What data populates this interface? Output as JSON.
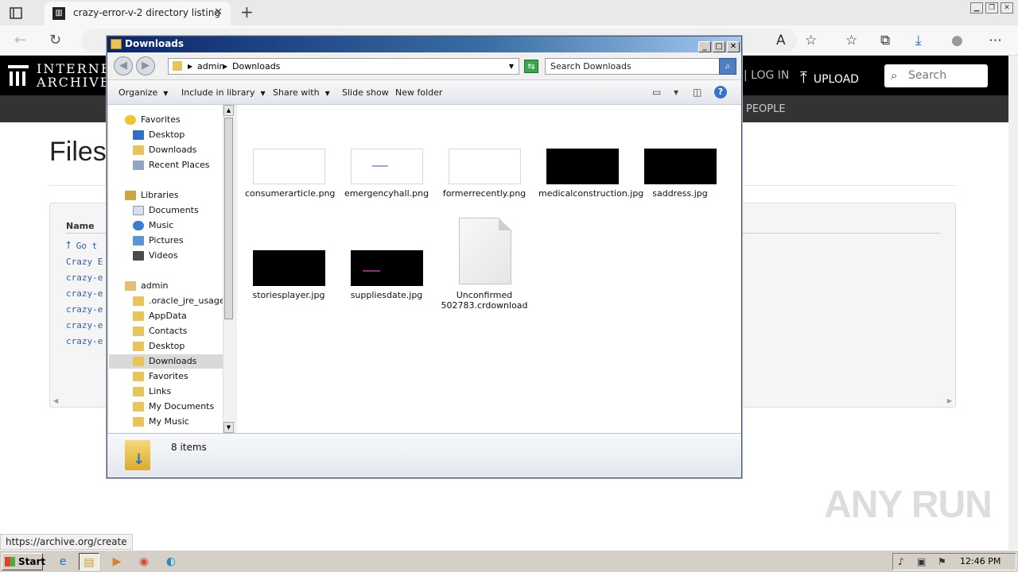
{
  "browser": {
    "tab_title": "crazy-error-v-2 directory listing",
    "tab_close": "✕",
    "new_tab": "+",
    "window_buttons": [
      "▁",
      "❐",
      "✕"
    ],
    "icons": [
      "back-icon",
      "refresh-icon",
      "read-aloud-icon",
      "add-favorite-icon",
      "favorites-icon",
      "collections-icon",
      "downloads-icon",
      "profile-icon",
      "more-icon"
    ]
  },
  "archive": {
    "logo_line1": "INTERNE",
    "logo_line2": "ARCHIVE",
    "login": "| LOG IN",
    "upload": "UPLOAD",
    "search_placeholder": "Search",
    "nav_people": "PEOPLE",
    "heading": "Files",
    "column_name": "Name",
    "rows": [
      "Go t",
      "Crazy E",
      "crazy-e",
      "crazy-e",
      "crazy-e",
      "crazy-e",
      "crazy-e"
    ],
    "status_url": "https://archive.org/create",
    "watermark": "ANY RUN"
  },
  "explorer": {
    "title": "Downloads",
    "controls": [
      "_",
      "□",
      "✕"
    ],
    "address": {
      "crumb1": "admin",
      "crumb2": "Downloads"
    },
    "search_placeholder": "Search Downloads",
    "commands": {
      "organize": "Organize",
      "include_in_library": "Include in library",
      "share_with": "Share with",
      "slide_show": "Slide show",
      "new_folder": "New folder"
    },
    "nav": {
      "favorites_header": "Favorites",
      "favorites": [
        "Desktop",
        "Downloads",
        "Recent Places"
      ],
      "libraries_header": "Libraries",
      "libraries": [
        "Documents",
        "Music",
        "Pictures",
        "Videos"
      ],
      "user_header": "admin",
      "user_folders": [
        ".oracle_jre_usage",
        "AppData",
        "Contacts",
        "Desktop",
        "Downloads",
        "Favorites",
        "Links",
        "My Documents",
        "My Music"
      ]
    },
    "files": [
      {
        "name": "consumerarticle.png",
        "thumb": "#ffffff"
      },
      {
        "name": "emergencyhall.png",
        "thumb": "#ffffff"
      },
      {
        "name": "formerrecently.png",
        "thumb": "#ffffff"
      },
      {
        "name": "medicalconstruction.jpg",
        "thumb": "#000000"
      },
      {
        "name": "saddress.jpg",
        "thumb": "#000000"
      },
      {
        "name": "storiesplayer.jpg",
        "thumb": "#000000"
      },
      {
        "name": "suppliesdate.jpg",
        "thumb": "#000000"
      },
      {
        "name": "Unconfirmed 502783.crdownload",
        "thumb": "document"
      }
    ],
    "item_count": "8 items"
  },
  "taskbar": {
    "start": "Start",
    "clock": "12:46 PM",
    "apps": [
      "ie-icon",
      "explorer-icon",
      "media-player-icon",
      "chrome-icon",
      "edge-icon"
    ]
  }
}
